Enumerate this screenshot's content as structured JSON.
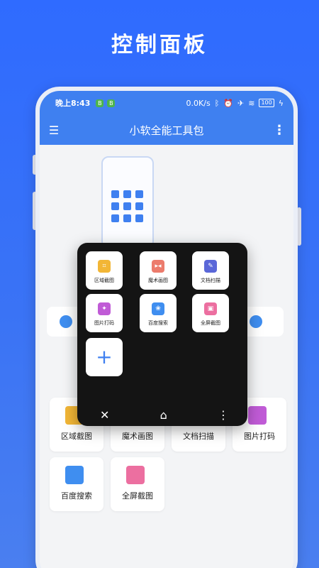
{
  "headline": "控制面板",
  "status": {
    "time": "晚上8:43",
    "badge1": "B",
    "badge2": "B",
    "speed": "0.0K/s",
    "battery": "100"
  },
  "appbar": {
    "title": "小软全能工具包"
  },
  "background_cards": [
    {
      "label": "区域截图",
      "color": "#f2b636"
    },
    {
      "label": "魔术画图",
      "color": "#ec7b6c"
    },
    {
      "label": "文档扫描",
      "color": "#5a67d8"
    },
    {
      "label": "图片打码",
      "color": "#c05bd6"
    },
    {
      "label": "百度搜索",
      "color": "#3f8ef0"
    },
    {
      "label": "全屏截图",
      "color": "#ec6fa0"
    }
  ],
  "panel": {
    "tiles": [
      {
        "label": "区域截图",
        "color": "#f2b636",
        "glyph": "⌗"
      },
      {
        "label": "魔术画图",
        "color": "#ec7b6c",
        "glyph": "▸◂"
      },
      {
        "label": "文档扫描",
        "color": "#5a67d8",
        "glyph": "✎"
      },
      {
        "label": "图片打码",
        "color": "#c05bd6",
        "glyph": "✦"
      },
      {
        "label": "百度搜索",
        "color": "#3f8ef0",
        "glyph": "❀"
      },
      {
        "label": "全屏截图",
        "color": "#ec6fa0",
        "glyph": "▣"
      }
    ],
    "add_glyph": "+",
    "nav": {
      "close": "✕",
      "home": "⌂",
      "more": "⋮"
    }
  }
}
